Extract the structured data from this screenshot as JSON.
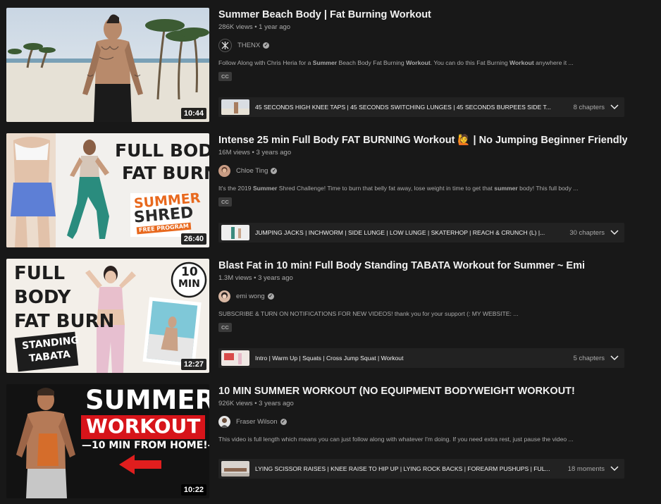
{
  "results": [
    {
      "title": "Summer Beach Body | Fat Burning Workout",
      "meta": "286K views • 1 year ago",
      "channel": "THENX",
      "avatar_icon": "thenx-logo-icon",
      "description_parts": [
        "Follow Along with Chris Heria for a ",
        "Summer",
        " Beach Body Fat Burning ",
        "Workout",
        ". You can do this Fat Burning ",
        "Workout",
        " anywhere it ..."
      ],
      "badge": "CC",
      "duration": "10:44",
      "chapters_text": "45 SECONDS HIGH KNEE TAPS | 45 SECONDS SWITCHING LUNGES | 45 SECONDS BURPEES SIDE T...",
      "chapters_count": "8 chapters"
    },
    {
      "title": "Intense 25 min Full Body FAT BURNING Workout 🙋 | No Jumping Beginner Friendly",
      "meta": "16M views • 3 years ago",
      "channel": "Chloe Ting",
      "avatar_icon": "chloe-ting-avatar",
      "description_parts": [
        "It's the 2019 ",
        "Summer",
        " Shred Challenge! Time to burn that belly fat away, lose weight in time to get that ",
        "summer",
        " body! This full body ..."
      ],
      "badge": "CC",
      "duration": "26:40",
      "thumb_text": [
        "FULL BODY",
        "FAT BURN",
        "SUMMER",
        "SHRED",
        "FREE PROGRAM"
      ],
      "chapters_text": "JUMPING JACKS | INCHWORM | SIDE LUNGE | LOW LUNGE | SKATERHOP | REACH & CRUNCH (L) |...",
      "chapters_count": "30 chapters"
    },
    {
      "title": "Blast Fat in 10 min! Full Body Standing TABATA Workout for Summer ~ Emi",
      "meta": "1.3M views • 3 years ago",
      "channel": "emi wong",
      "avatar_icon": "emi-wong-avatar",
      "description_parts": [
        "SUBSCRIBE & TURN ON NOTIFICATIONS FOR NEW VIDEOS! thank you for your support (: MY WEBSITE: ..."
      ],
      "badge": "CC",
      "duration": "12:27",
      "thumb_text": [
        "FULL",
        "BODY",
        "FAT BURN",
        "STANDING",
        "TABATA",
        "10",
        "MIN"
      ],
      "chapters_text": "Intro | Warm Up | Squats | Cross Jump Squat | Workout",
      "chapters_count": "5 chapters"
    },
    {
      "title": "10 MIN SUMMER WORKOUT (NO EQUIPMENT BODYWEIGHT WORKOUT!",
      "meta": "926K views • 3 years ago",
      "channel": "Fraser Wilson",
      "avatar_icon": "fraser-wilson-avatar",
      "description_parts": [
        "This video is full length which means you can just follow along with whatever I'm doing. If you need extra rest, just pause the video ..."
      ],
      "badge": "",
      "duration": "10:22",
      "thumb_text": [
        "SUMMER",
        "WORKOUT",
        "—10 MIN FROM HOME!—"
      ],
      "chapters_text": "LYING SCISSOR RAISES | KNEE RAISE TO HIP UP | LYING ROCK BACKS | FOREARM PUSHUPS | FUL...",
      "chapters_count": "18 moments"
    }
  ],
  "colors": {
    "background": "#181818",
    "title": "#f1f1f1",
    "secondary": "#aaaaaa",
    "chapters_bg": "#222222",
    "summer_orange": "#e8691e",
    "workout_red": "#d7141a"
  }
}
